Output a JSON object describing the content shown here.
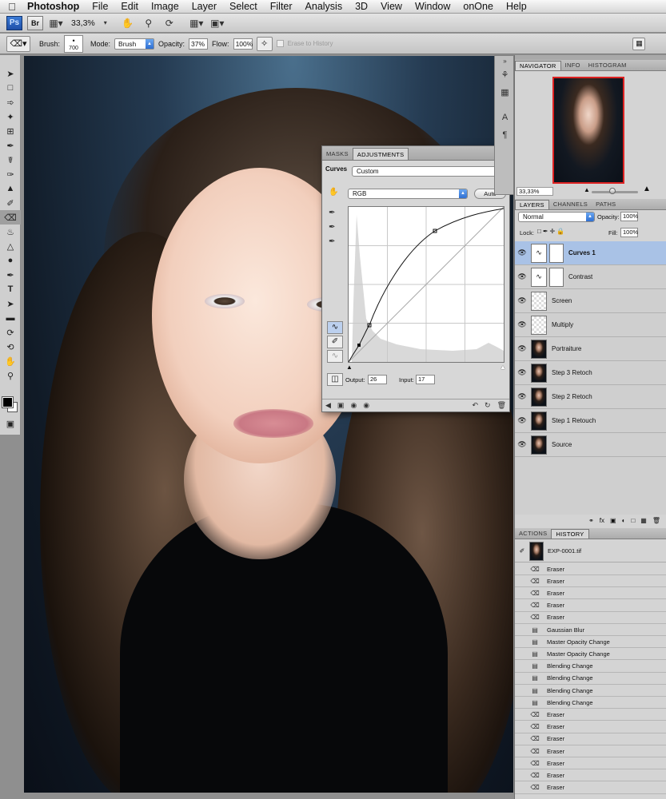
{
  "menubar": {
    "items": [
      "Photoshop",
      "File",
      "Edit",
      "Image",
      "Layer",
      "Select",
      "Filter",
      "Analysis",
      "3D",
      "View",
      "Window",
      "onOne",
      "Help"
    ]
  },
  "appbar": {
    "ps_badge": "Ps",
    "br_badge": "Br",
    "zoom": "33,3%"
  },
  "options": {
    "brush_label": "Brush:",
    "brush_size": "700",
    "mode_label": "Mode:",
    "mode_value": "Brush",
    "opacity_label": "Opacity:",
    "opacity_value": "37%",
    "flow_label": "Flow:",
    "flow_value": "100%",
    "erase_history_label": "Erase to History"
  },
  "adjustments": {
    "tabs": [
      "MASKS",
      "ADJUSTMENTS"
    ],
    "active_tab": "ADJUSTMENTS",
    "type_label": "Curves",
    "preset_value": "Custom",
    "channel_value": "RGB",
    "auto_label": "Auto",
    "output_label": "Output:",
    "output_value": "26",
    "input_label": "Input:",
    "input_value": "17"
  },
  "navigator": {
    "tabs": [
      "NAVIGATOR",
      "INFO",
      "HISTOGRAM"
    ],
    "zoom": "33,33%",
    "zoom_fraction": 0.45
  },
  "layers": {
    "tabs": [
      "LAYERS",
      "CHANNELS",
      "PATHS"
    ],
    "blend_mode": "Normal",
    "opacity_label": "Opacity:",
    "opacity_value": "100%",
    "lock_label": "Lock:",
    "fill_label": "Fill:",
    "fill_value": "100%",
    "items": [
      {
        "name": "Curves 1",
        "thumb": "adjustment",
        "selected": true
      },
      {
        "name": "Contrast",
        "thumb": "adjustment",
        "selected": false
      },
      {
        "name": "Screen",
        "thumb": "transparent",
        "selected": false
      },
      {
        "name": "Multiply",
        "thumb": "transparent",
        "selected": false
      },
      {
        "name": "Portraiture",
        "thumb": "photo",
        "selected": false
      },
      {
        "name": "Step 3 Retoch",
        "thumb": "photo",
        "selected": false
      },
      {
        "name": "Step 2 Retoch",
        "thumb": "photo",
        "selected": false
      },
      {
        "name": "Step 1 Retouch",
        "thumb": "photo",
        "selected": false
      },
      {
        "name": "Source",
        "thumb": "photo",
        "selected": false
      }
    ]
  },
  "history": {
    "tabs": [
      "ACTIONS",
      "HISTORY"
    ],
    "snapshot": "EXP-0001.tif",
    "items": [
      "Eraser",
      "Eraser",
      "Eraser",
      "Eraser",
      "Eraser",
      "Gaussian Blur",
      "Master Opacity Change",
      "Master Opacity Change",
      "Blending Change",
      "Blending Change",
      "Blending Change",
      "Blending Change",
      "Eraser",
      "Eraser",
      "Eraser",
      "Eraser",
      "Eraser",
      "Eraser",
      "Eraser"
    ]
  },
  "colors": {
    "selection": "#a9c2e6",
    "accent_blue": "#2f6fd1",
    "navigator_frame": "#dd2222"
  }
}
